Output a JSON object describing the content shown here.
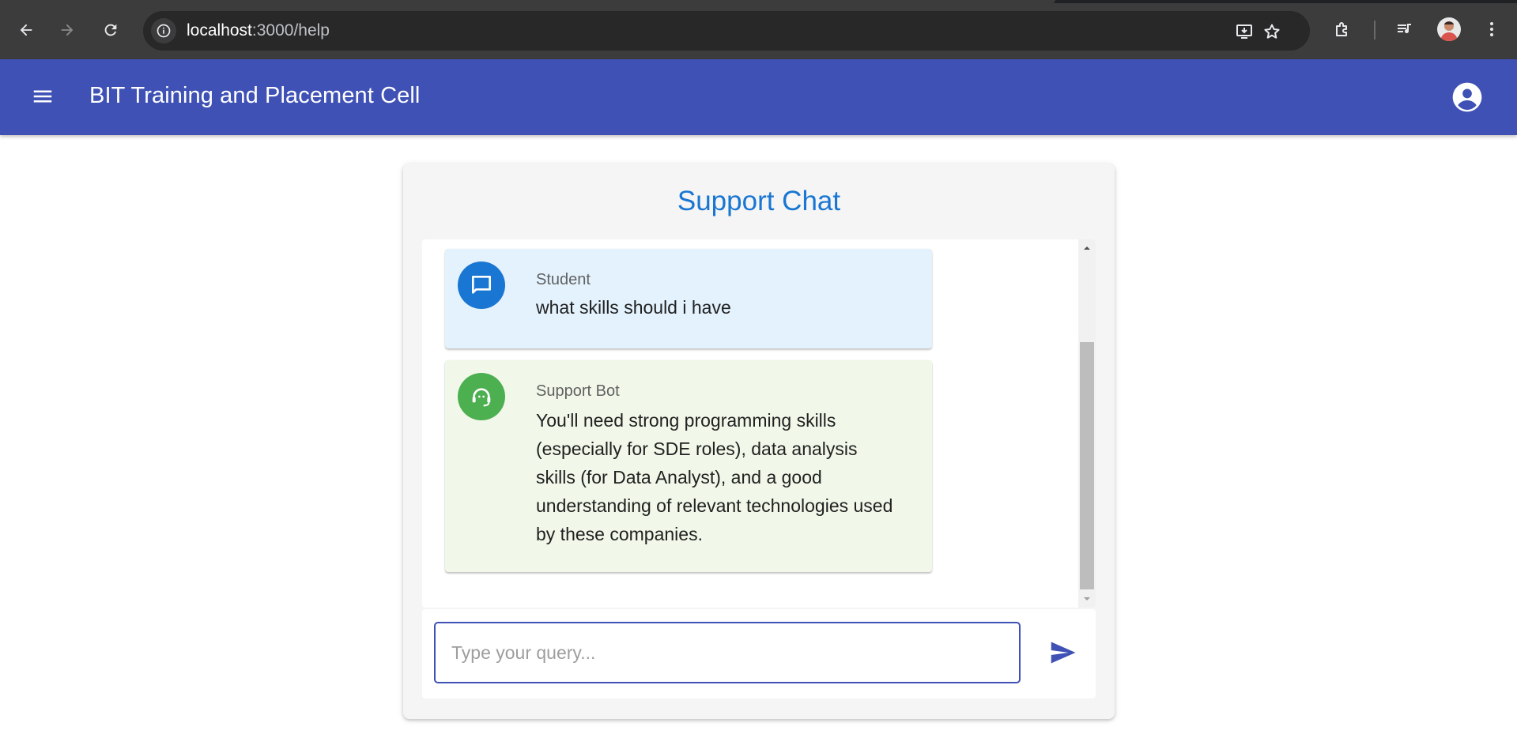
{
  "browser": {
    "url_host": "localhost",
    "url_path": ":3000/help"
  },
  "appbar": {
    "title": "BIT Training and Placement Cell"
  },
  "chat": {
    "title": "Support Chat",
    "messages": [
      {
        "sender": "Student",
        "text": "what skills should i have",
        "avatar_icon": "chat-bubble-icon",
        "color": "#1976d2"
      },
      {
        "sender": "Support Bot",
        "text": "You'll need strong programming skills (especially for SDE roles), data analysis skills (for Data Analyst), and a good understanding of relevant technologies used by these companies.",
        "avatar_icon": "headset-support-icon",
        "color": "#4caf50"
      }
    ],
    "input": {
      "placeholder": "Type your query...",
      "value": ""
    }
  },
  "colors": {
    "appbar": "#3f51b5",
    "title": "#1976d2",
    "student_bubble": "#e3f2fd",
    "bot_bubble": "#f1f8e9"
  }
}
